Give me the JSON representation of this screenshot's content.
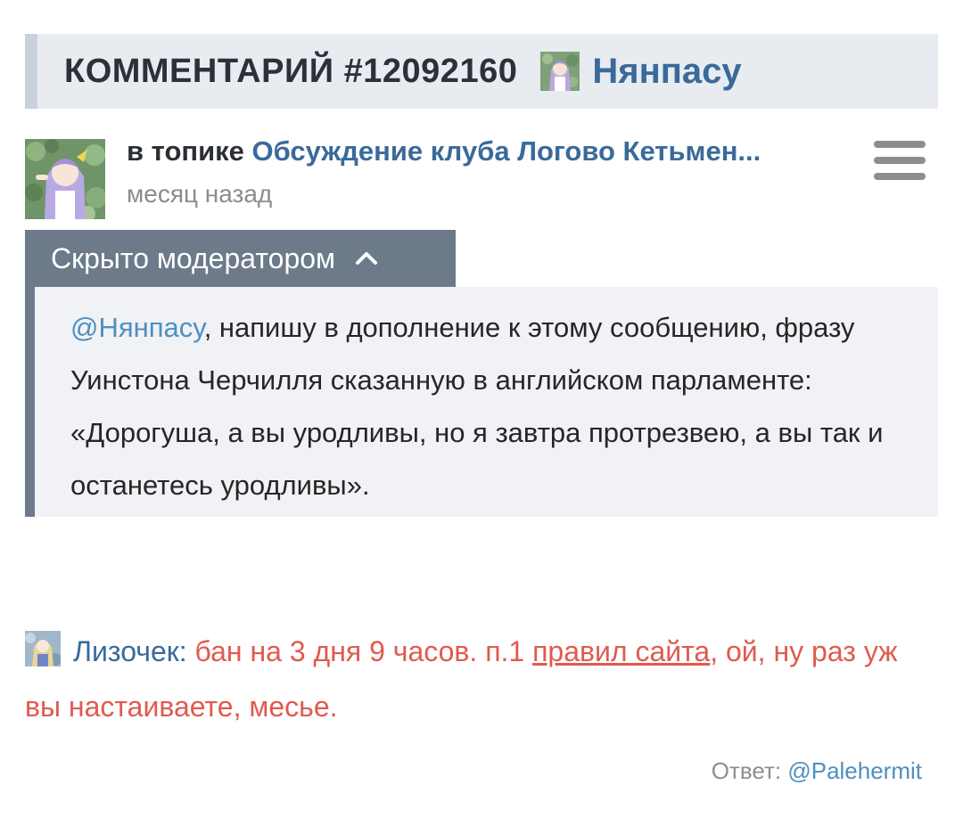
{
  "header": {
    "title": "КОММЕНТАРИЙ #12092160",
    "user": "Нянпасу"
  },
  "meta": {
    "topic_prefix": "в топике",
    "topic_link": "Обсуждение клуба Логово Кетьмен...",
    "time_ago": "месяц назад"
  },
  "hidden": {
    "label": "Скрыто модератором",
    "mention": "@Нянпасу",
    "text": ", напишу в дополнение к этому сообщению, фразу Уинстона Черчилля сказанную в английском парламенте: «Дорогуша, а вы уродливы, но я завтра протрезвею, а вы так и останетесь уродливы»."
  },
  "moderator": {
    "name": "Лизочек",
    "colon": ":",
    "text_before": " бан на 3 дня 9 часов. п.1 ",
    "rules_link": "правил сайта",
    "text_after": ", ой, ну раз уж вы настаиваете, месье."
  },
  "reply": {
    "label": "Ответ:",
    "mention": "@Palehermit"
  },
  "colors": {
    "link_blue": "#3a6a9a",
    "mention_blue": "#4f8fc0",
    "moderator_red": "#e05a4f",
    "hidden_bar": "#6c7a89"
  },
  "icons": {
    "menu": "hamburger-menu-icon",
    "collapse": "chevron-up-icon"
  }
}
